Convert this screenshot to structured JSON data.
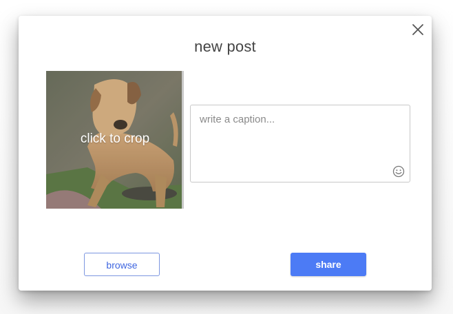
{
  "modal": {
    "title": "new post",
    "close_icon": "close-icon"
  },
  "photo": {
    "overlay_label": "click to crop"
  },
  "caption": {
    "placeholder": "write a caption...",
    "value": "",
    "emoji_icon": "smiley-icon"
  },
  "actions": {
    "browse_label": "browse",
    "share_label": "share"
  },
  "colors": {
    "accent": "#4c7bf5",
    "browse_border": "#7b95e0",
    "title_text": "#444444"
  }
}
